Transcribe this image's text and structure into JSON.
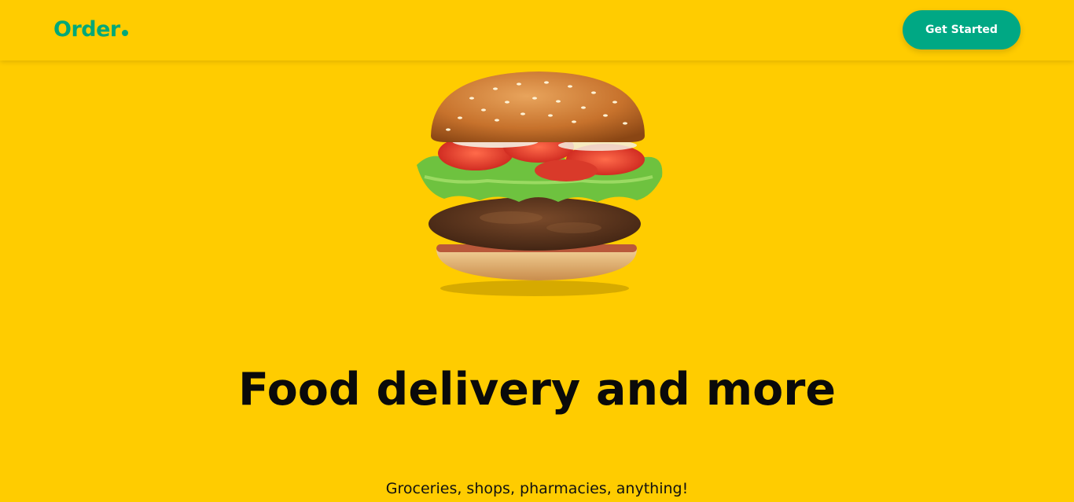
{
  "header": {
    "logo_text": "Order",
    "cta_label": "Get Started"
  },
  "hero": {
    "image_subject": "burger",
    "headline": "Food delivery and more",
    "subline": "Groceries, shops, pharmacies, anything!"
  },
  "colors": {
    "background": "#ffcc00",
    "accent": "#00a884",
    "text": "#0a0a0a"
  }
}
